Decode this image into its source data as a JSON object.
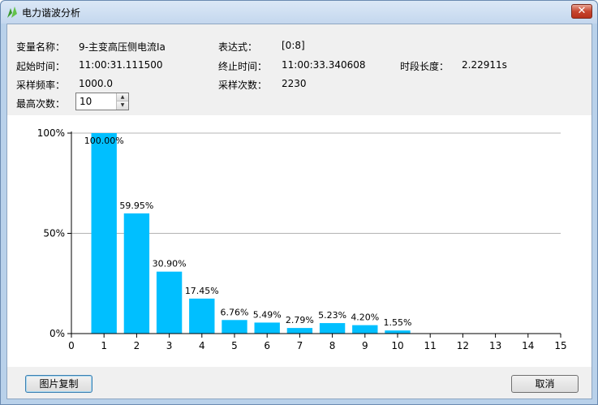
{
  "window": {
    "title": "电力谐波分析",
    "close_label": "✕"
  },
  "info": {
    "variable_label": "变量名称：",
    "variable_value": "9-主变高压侧电流Ia",
    "expression_label": "表达式：",
    "expression_value": "[0:8]",
    "start_label": "起始时间：",
    "start_value": "11:00:31.111500",
    "end_label": "终止时间：",
    "end_value": "11:00:33.340608",
    "duration_label": "时段长度：",
    "duration_value": "2.22911s",
    "freq_label": "采样频率：",
    "freq_value": "1000.0",
    "count_label": "采样次数：",
    "count_value": "2230",
    "max_order_label": "最高次数：",
    "max_order_value": "10"
  },
  "buttons": {
    "copy_label": "图片复制",
    "cancel_label": "取消"
  },
  "colors": {
    "bar": "#00bfff",
    "grid": "#b4b4b4"
  },
  "chart_data": {
    "type": "bar",
    "x": [
      1,
      2,
      3,
      4,
      5,
      6,
      7,
      8,
      9,
      10
    ],
    "values": [
      100.0,
      59.95,
      30.9,
      17.45,
      6.76,
      5.49,
      2.79,
      5.23,
      4.2,
      1.55
    ],
    "value_labels": [
      "100.00%",
      "59.95%",
      "30.90%",
      "17.45%",
      "6.76%",
      "5.49%",
      "2.79%",
      "5.23%",
      "4.20%",
      "1.55%"
    ],
    "xlim": [
      0,
      15
    ],
    "ylim": [
      0,
      100
    ],
    "x_ticks": [
      "0",
      "1",
      "2",
      "3",
      "4",
      "5",
      "6",
      "7",
      "8",
      "9",
      "10",
      "11",
      "12",
      "13",
      "14",
      "15"
    ],
    "y_ticks": [
      {
        "value": 0,
        "label": "0%"
      },
      {
        "value": 50,
        "label": "50%"
      },
      {
        "value": 100,
        "label": "100%"
      }
    ],
    "grid": true
  }
}
